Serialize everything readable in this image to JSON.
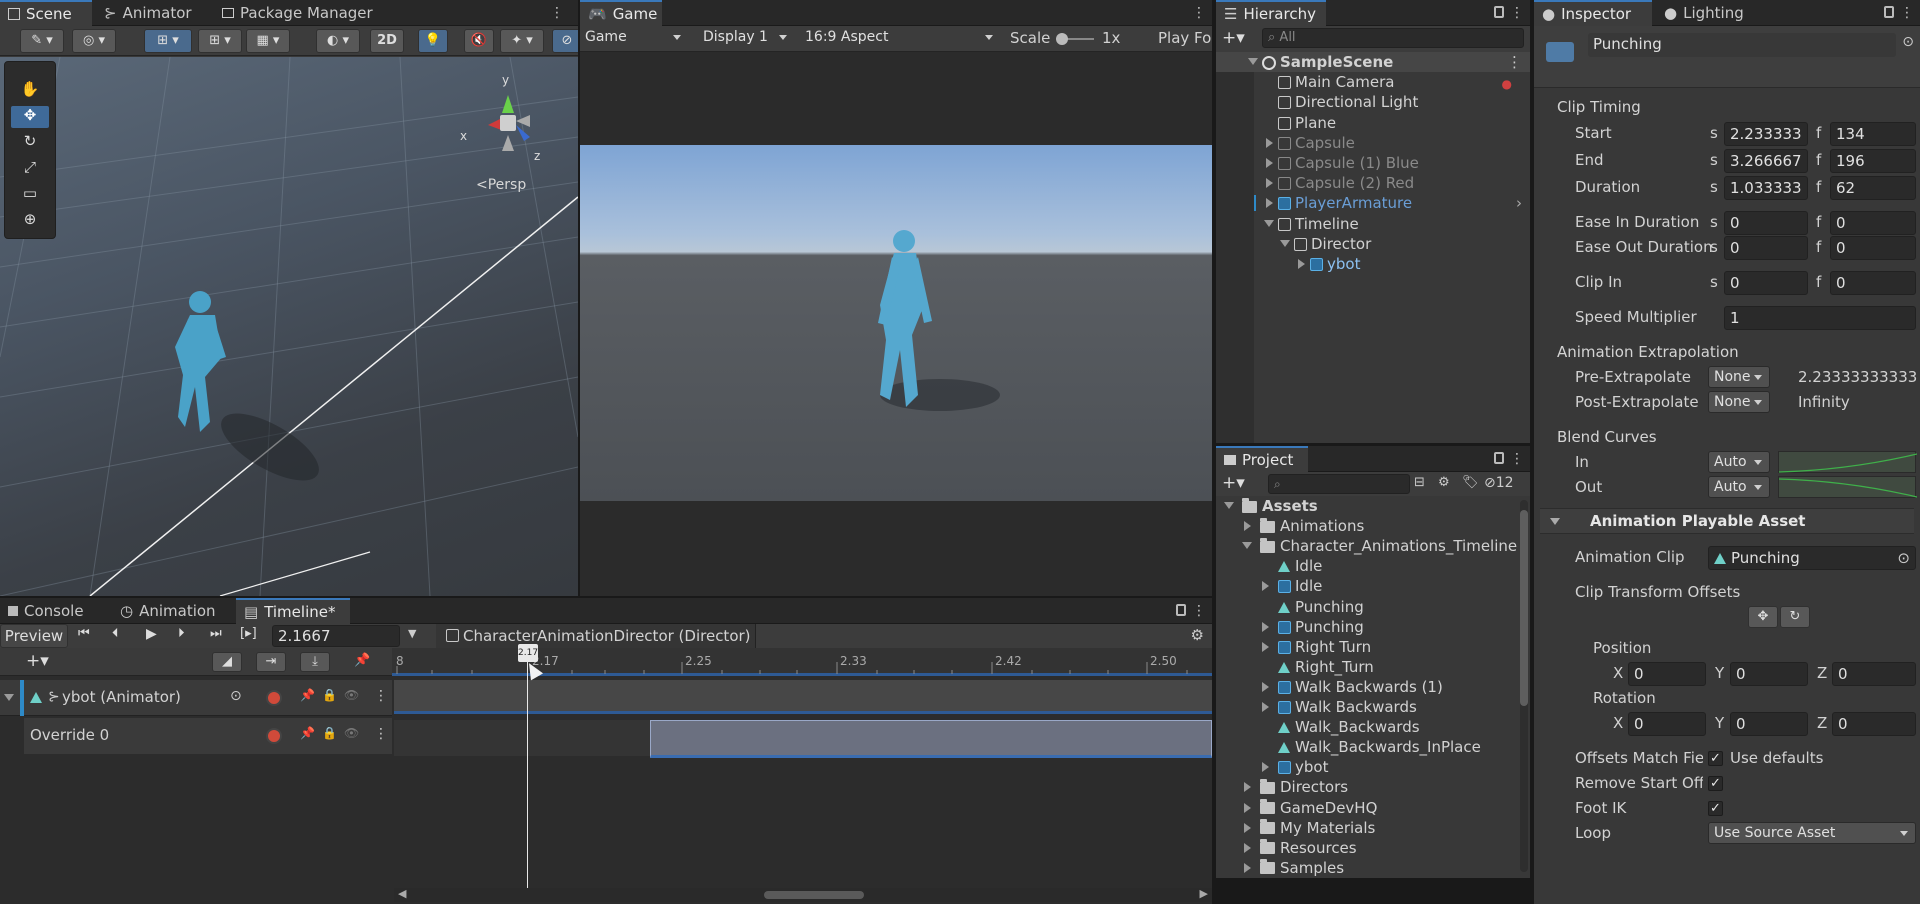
{
  "scene": {
    "tabs": [
      "Scene",
      "Animator",
      "Package Manager"
    ],
    "toolbar": {
      "mode_2d": "2D"
    },
    "gizmo": {
      "x": "x",
      "y": "y",
      "z": "z",
      "persp": "<Persp"
    }
  },
  "game": {
    "tab": "Game",
    "toolbar": {
      "view": "Game",
      "display": "Display 1",
      "aspect": "16:9 Aspect",
      "scale_label": "Scale",
      "scale_value": "1x",
      "play_focus": "Play Fo"
    }
  },
  "hierarchy": {
    "tab": "Hierarchy",
    "search_placeholder": "All",
    "items": [
      {
        "label": "SampleScene",
        "depth": 0,
        "kind": "scene",
        "expanded": true
      },
      {
        "label": "Main Camera",
        "depth": 1,
        "kind": "cube"
      },
      {
        "label": "Directional Light",
        "depth": 1,
        "kind": "cube"
      },
      {
        "label": "Plane",
        "depth": 1,
        "kind": "cube"
      },
      {
        "label": "Capsule",
        "depth": 1,
        "kind": "dim",
        "collapsed": true
      },
      {
        "label": "Capsule (1) Blue",
        "depth": 1,
        "kind": "dim",
        "collapsed": true
      },
      {
        "label": "Capsule (2) Red",
        "depth": 1,
        "kind": "dim",
        "collapsed": true
      },
      {
        "label": "PlayerArmature",
        "depth": 1,
        "kind": "prefab",
        "collapsed": true
      },
      {
        "label": "Timeline",
        "depth": 1,
        "kind": "cube",
        "expanded": true
      },
      {
        "label": "Director",
        "depth": 2,
        "kind": "cube",
        "expanded": true
      },
      {
        "label": "ybot",
        "depth": 3,
        "kind": "prefab",
        "collapsed": true
      }
    ]
  },
  "project": {
    "tab": "Project",
    "hidden_count": "12",
    "items": [
      {
        "label": "Assets",
        "depth": 0,
        "kind": "folder",
        "expanded": true
      },
      {
        "label": "Animations",
        "depth": 1,
        "kind": "folder",
        "collapsed": true
      },
      {
        "label": "Character_Animations_Timeline",
        "depth": 1,
        "kind": "folder",
        "expanded": true
      },
      {
        "label": "Idle",
        "depth": 2,
        "kind": "anim"
      },
      {
        "label": "Idle",
        "depth": 2,
        "kind": "model",
        "collapsed": true
      },
      {
        "label": "Punching",
        "depth": 2,
        "kind": "anim"
      },
      {
        "label": "Punching",
        "depth": 2,
        "kind": "model",
        "collapsed": true
      },
      {
        "label": "Right Turn",
        "depth": 2,
        "kind": "model",
        "collapsed": true
      },
      {
        "label": "Right_Turn",
        "depth": 2,
        "kind": "anim"
      },
      {
        "label": "Walk Backwards (1)",
        "depth": 2,
        "kind": "model",
        "collapsed": true
      },
      {
        "label": "Walk Backwards",
        "depth": 2,
        "kind": "model",
        "collapsed": true
      },
      {
        "label": "Walk_Backwards",
        "depth": 2,
        "kind": "anim"
      },
      {
        "label": "Walk_Backwards_InPlace",
        "depth": 2,
        "kind": "anim"
      },
      {
        "label": "ybot",
        "depth": 2,
        "kind": "model",
        "collapsed": true
      },
      {
        "label": "Directors",
        "depth": 1,
        "kind": "folder",
        "collapsed": true
      },
      {
        "label": "GameDevHQ",
        "depth": 1,
        "kind": "folder",
        "collapsed": true
      },
      {
        "label": "My Materials",
        "depth": 1,
        "kind": "folder",
        "collapsed": true
      },
      {
        "label": "Resources",
        "depth": 1,
        "kind": "folder",
        "collapsed": true
      },
      {
        "label": "Samples",
        "depth": 1,
        "kind": "folder",
        "collapsed": true
      }
    ]
  },
  "inspector": {
    "tabs": [
      "Inspector",
      "Lighting"
    ],
    "object_name": "Punching",
    "clip_timing": {
      "header": "Clip Timing",
      "start_label": "Start",
      "start_s": "2.233333",
      "start_f": "134",
      "end_label": "End",
      "end_s": "3.266667",
      "end_f": "196",
      "duration_label": "Duration",
      "duration_s": "1.033333",
      "duration_f": "62",
      "ease_in_label": "Ease In Duration",
      "ease_in_s": "0",
      "ease_in_f": "0",
      "ease_out_label": "Ease Out Duration",
      "ease_out_s": "0",
      "ease_out_f": "0",
      "clip_in_label": "Clip In",
      "clip_in_s": "0",
      "clip_in_f": "0",
      "speed_label": "Speed Multiplier",
      "speed": "1",
      "s": "s",
      "f": "f"
    },
    "extrapolation": {
      "header": "Animation Extrapolation",
      "pre_label": "Pre-Extrapolate",
      "pre_value": "None",
      "pre_time": "2.23333333333",
      "post_label": "Post-Extrapolate",
      "post_value": "None",
      "post_time": "Infinity"
    },
    "blend": {
      "header": "Blend Curves",
      "in_label": "In",
      "in_value": "Auto",
      "out_label": "Out",
      "out_value": "Auto"
    },
    "playable": {
      "header": "Animation Playable Asset",
      "clip_label": "Animation Clip",
      "clip_value": "Punching",
      "offsets_label": "Clip Transform Offsets",
      "position_label": "Position",
      "rotation_label": "Rotation",
      "px": "0",
      "py": "0",
      "pz": "0",
      "rx": "0",
      "ry": "0",
      "rz": "0",
      "axis_x": "X",
      "axis_y": "Y",
      "axis_z": "Z",
      "match_label": "Offsets Match Fiel",
      "match_value": "Use defaults",
      "remove_label": "Remove Start Offs",
      "footik_label": "Foot IK",
      "loop_label": "Loop",
      "loop_value": "Use Source Asset"
    }
  },
  "timeline": {
    "tabs": [
      "Console",
      "Animation",
      "Timeline*"
    ],
    "preview": "Preview",
    "time": "2.1667",
    "director": "CharacterAnimationDirector (Director)",
    "playhead_label": "2.17",
    "ruler": [
      "8",
      "2.17",
      "2.25",
      "2.33",
      "2.42",
      "2.50"
    ],
    "tracks": [
      {
        "name": "ybot (Animator)"
      },
      {
        "name": "Override 0"
      }
    ]
  }
}
